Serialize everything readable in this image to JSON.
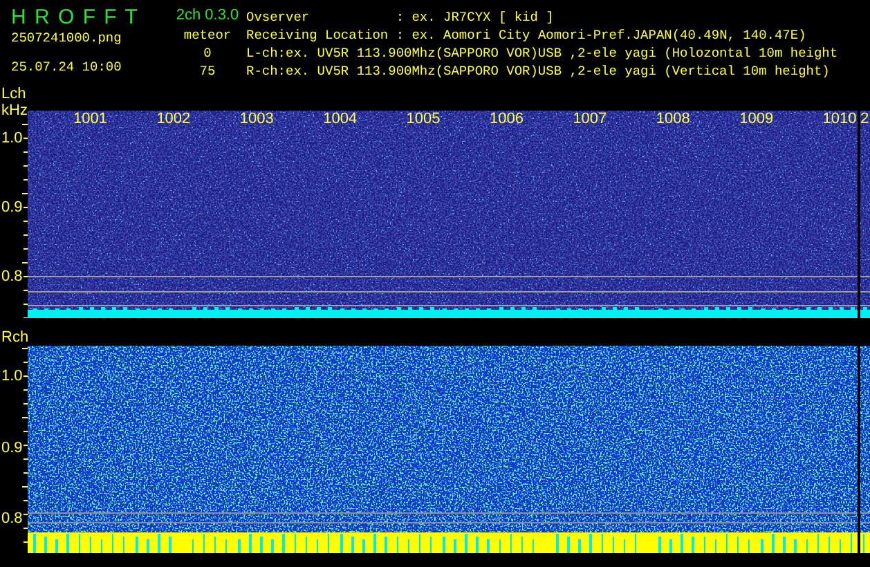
{
  "header": {
    "app_title": "H R O F F T",
    "version": "2ch 0.3.0",
    "filename": "2507241000.png",
    "datetime": "25.07.24 10:00",
    "meteor_label": "meteor",
    "meteor_counts": [
      "0",
      "75"
    ]
  },
  "info": [
    {
      "label": "Ovserver",
      "value": ": ex. JR7CYX [ kid ]"
    },
    {
      "label": "Receiving Location",
      "value": ": ex. Aomori City Aomori-Pref.JAPAN(40.49N, 140.47E)"
    },
    {
      "label": "L-ch:ex. UV5R 113.900Mhz(SAPPORO VOR)USB ,2-ele yagi (Holozontal 10m height"
    },
    {
      "label": "R-ch:ex. UV5R 113.900Mhz(SAPPORO VOR)USB ,2-ele yagi (Vertical 10m height)"
    }
  ],
  "time_ticks": [
    "1001",
    "1002",
    "1003",
    "1004",
    "1005",
    "1006",
    "1007",
    "1008",
    "1009",
    "1010"
  ],
  "time_tick_cut": "2",
  "panels": [
    {
      "kind": "lch",
      "label": "Lch",
      "unit": "kHz",
      "yticks": [
        "1.0",
        "0.9",
        "0.8"
      ]
    },
    {
      "kind": "rch",
      "label": "Rch",
      "yticks": [
        "1.0",
        "0.9",
        "0.8"
      ]
    }
  ]
}
